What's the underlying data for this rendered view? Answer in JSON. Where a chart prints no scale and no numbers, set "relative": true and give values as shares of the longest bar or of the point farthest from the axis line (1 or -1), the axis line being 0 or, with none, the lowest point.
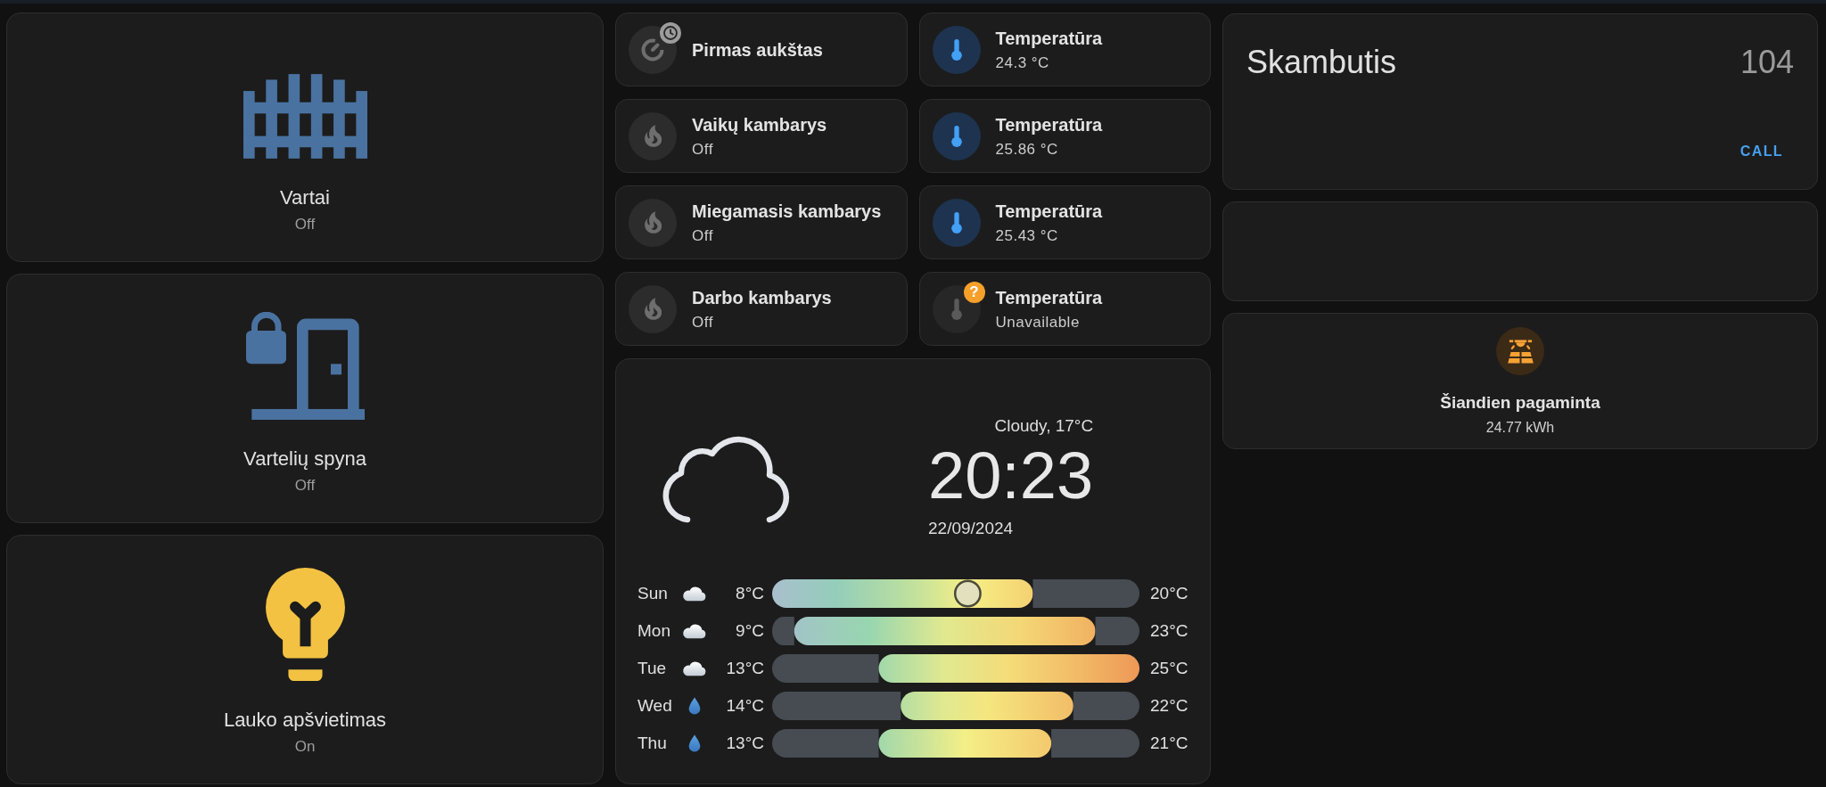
{
  "left_cards": [
    {
      "kind": "gate",
      "name": "Vartai",
      "state": "Off",
      "on": false
    },
    {
      "kind": "door_lock",
      "name": "Vartelių spyna",
      "state": "Off",
      "on": false
    },
    {
      "kind": "bulb",
      "name": "Lauko apšvietimas",
      "state": "On",
      "on": true
    }
  ],
  "climate_tiles": [
    {
      "kind": "thermostat",
      "name": "Pirmas aukštas",
      "on": false,
      "badge": {
        "kind": "clock"
      }
    },
    {
      "kind": "heater",
      "name": "Vaikų kambarys",
      "state": "Off",
      "on": false
    },
    {
      "kind": "heater",
      "name": "Miegamasis kambarys",
      "state": "Off",
      "on": false
    },
    {
      "kind": "heater",
      "name": "Darbo kambarys",
      "state": "Off",
      "on": false
    }
  ],
  "temperature_tiles": [
    {
      "name": "Temperatūra",
      "state": "24.3 °C",
      "available": true
    },
    {
      "name": "Temperatūra",
      "state": "25.86 °C",
      "available": true
    },
    {
      "name": "Temperatūra",
      "state": "25.43 °C",
      "available": true
    },
    {
      "name": "Temperatūra",
      "state": "Unavailable",
      "available": false,
      "badge_text": "?"
    }
  ],
  "weather": {
    "kind": "cloudy",
    "condition": "Cloudy, 17°C",
    "time": "20:23",
    "date": "22/09/2024",
    "forecast": [
      {
        "kind": "cloudy",
        "low": "8°C",
        "high": "20°C",
        "current": {
          "level": 0.75
        }
      },
      {
        "kind": "cloudy",
        "low": "9°C",
        "high": "23°C"
      },
      {
        "kind": "cloudy",
        "low": "13°C",
        "high": "25°C"
      },
      {
        "kind": "rainy",
        "low": "14°C",
        "high": "22°C"
      },
      {
        "kind": "rainy",
        "low": "13°C",
        "high": "21°C"
      }
    ],
    "chart_data": {
      "type": "bar",
      "orientation": "horizontal",
      "stacked": true,
      "relative": true,
      "categories": [
        "Sun",
        "Mon",
        "Tue",
        "Wed",
        "Thu"
      ],
      "series": [
        {
          "values": [
            0,
            0.06,
            0.29,
            0.35,
            0.29
          ]
        },
        {
          "values": [
            0.71,
            0.82,
            0.71,
            0.47,
            0.47
          ]
        },
        {
          "values": [
            0.29,
            0.12,
            0,
            0.18,
            0.24
          ]
        }
      ]
    }
  },
  "right_cards": [
    {
      "kind": "call",
      "title": "Skambutis",
      "number": "104",
      "action": "CALL"
    },
    {
      "kind": "blank"
    },
    {
      "kind": "energy",
      "name": "Šiandien pagaminta",
      "value": "24.77 kWh"
    }
  ]
}
